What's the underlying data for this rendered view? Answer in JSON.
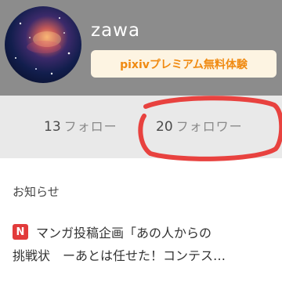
{
  "profile": {
    "username": "zawa",
    "premium_label": "pixivプレミアム無料体験"
  },
  "follow": {
    "following_count": "13",
    "following_label": "フォロー",
    "followers_count": "20",
    "followers_label": "フォロワー"
  },
  "news": {
    "title": "お知らせ",
    "items": [
      {
        "badge": "N",
        "line1": "マンガ投稿企画「あの人からの",
        "line2": "挑戦状　ーあとは任せた！コンテス…"
      }
    ]
  },
  "colors": {
    "header_bg": "#8c8c8c",
    "premium_text": "#f08a11",
    "premium_bg": "#fdf4e2",
    "follow_bar_bg": "#e9e9e9",
    "badge_bg": "#e23b3b",
    "annotation_red": "#e8423f"
  },
  "icons": {
    "avatar": "galaxy-nebula-avatar",
    "news_badge": "new-badge-icon"
  }
}
